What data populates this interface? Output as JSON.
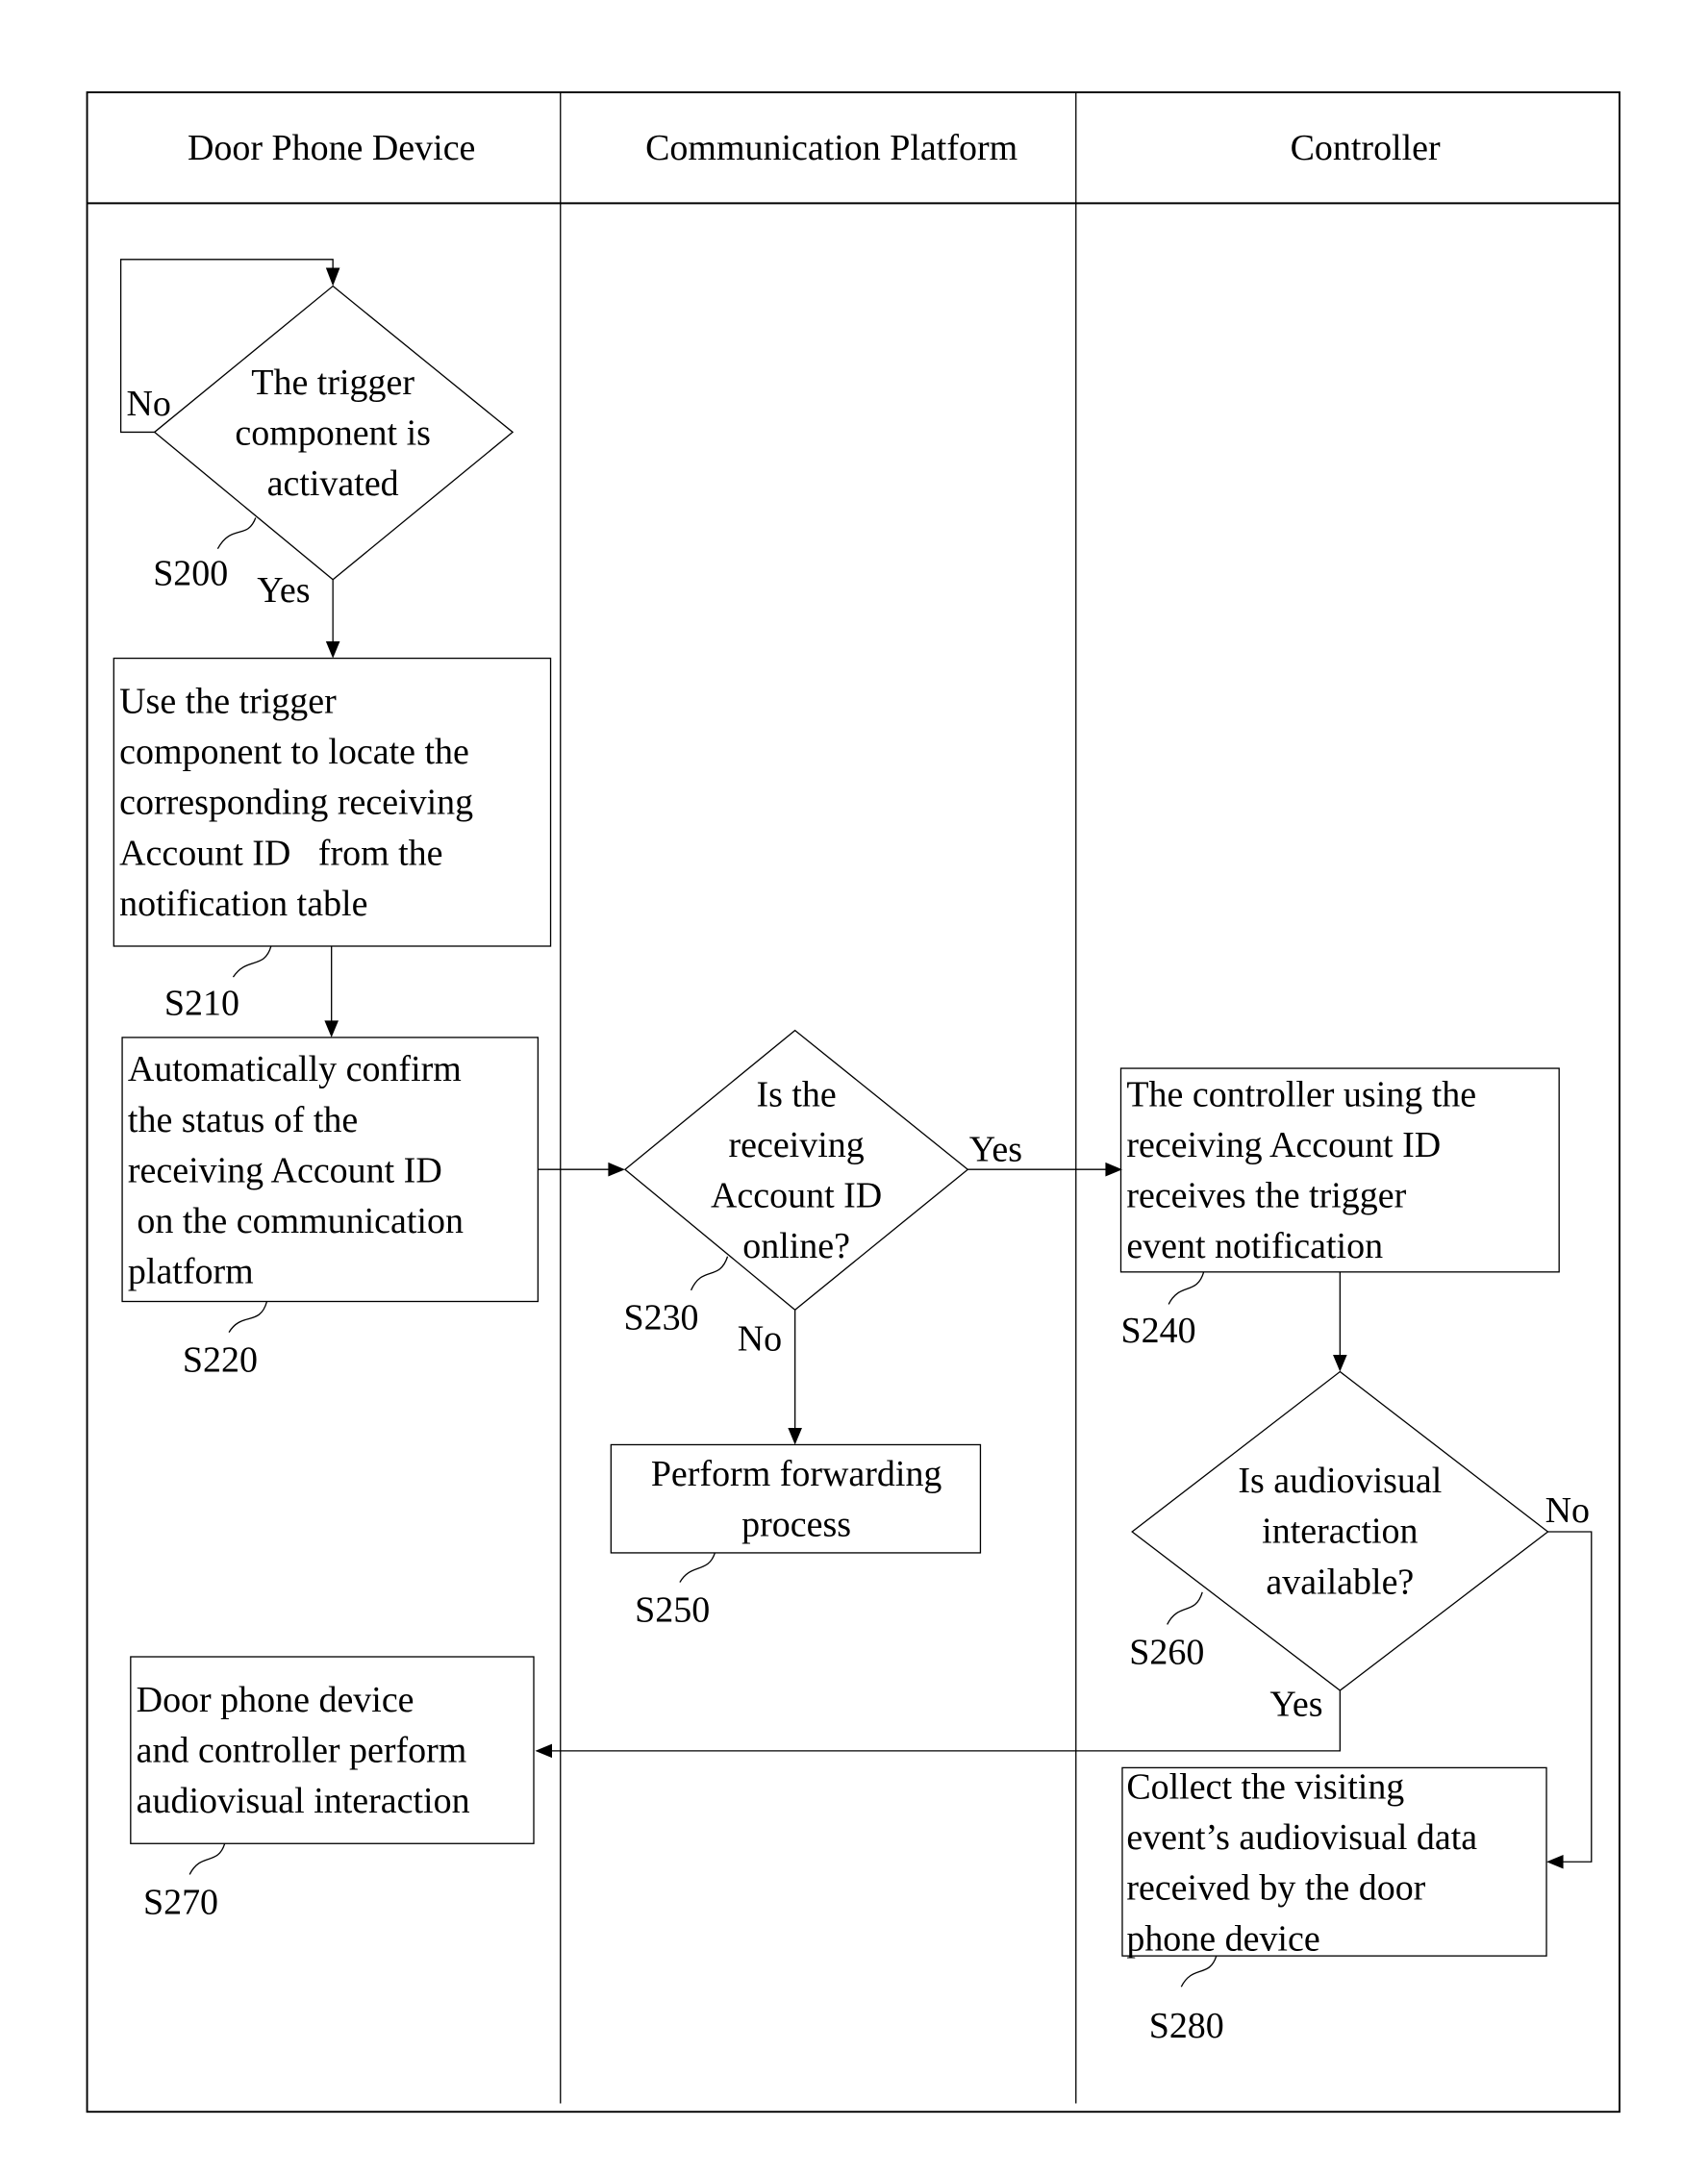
{
  "lanes": [
    {
      "label": "Door Phone Device"
    },
    {
      "label": "Communication Platform"
    },
    {
      "label": "Controller"
    }
  ],
  "steps": {
    "s200": {
      "id": "S200",
      "lines": [
        "The trigger",
        "component is",
        "activated"
      ]
    },
    "s210": {
      "id": "S210",
      "lines": [
        "Use the trigger",
        "component to locate the",
        "corresponding receiving",
        "Account ID   from the",
        "notification table"
      ]
    },
    "s220": {
      "id": "S220",
      "lines": [
        "Automatically confirm",
        "the status of the",
        "receiving Account ID",
        " on the communication",
        "platform"
      ]
    },
    "s230": {
      "id": "S230",
      "lines": [
        "Is the",
        "receiving",
        "Account ID",
        "online?"
      ]
    },
    "s240": {
      "id": "S240",
      "lines": [
        "The controller using the",
        "receiving Account ID",
        "receives the trigger",
        "event notification"
      ]
    },
    "s250": {
      "id": "S250",
      "lines": [
        "Perform forwarding",
        "process"
      ]
    },
    "s260": {
      "id": "S260",
      "lines": [
        "Is audiovisual",
        "interaction",
        "available?"
      ]
    },
    "s270": {
      "id": "S270",
      "lines": [
        "Door phone device",
        "and controller perform",
        "audiovisual interaction"
      ]
    },
    "s280": {
      "id": "S280",
      "lines": [
        "Collect the visiting",
        "event’s audiovisual data",
        "received by the door",
        "phone device"
      ]
    }
  },
  "branch_labels": {
    "s200_no": "No",
    "s200_yes": "Yes",
    "s230_yes": "Yes",
    "s230_no": "No",
    "s260_no": "No",
    "s260_yes": "Yes"
  }
}
